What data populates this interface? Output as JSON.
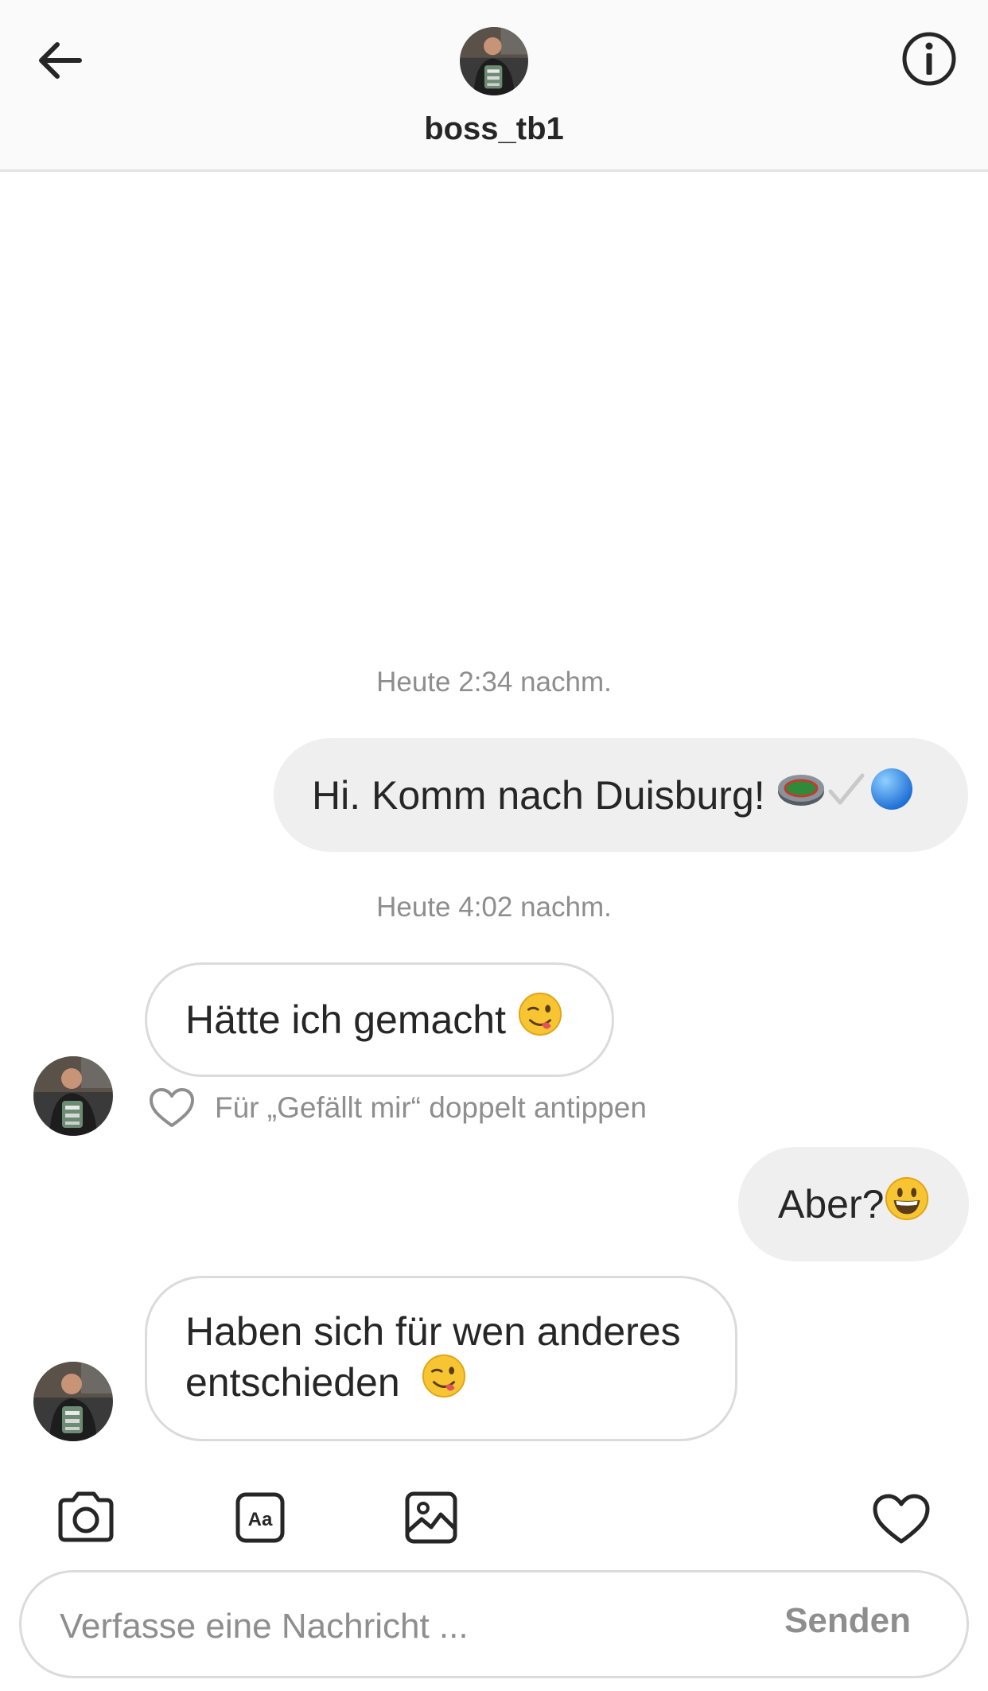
{
  "header": {
    "username": "boss_tb1",
    "back_icon": "arrow-left-icon",
    "info_icon": "info-circle-icon"
  },
  "thread": {
    "timestamp_1": "Heute 2:34 nachm.",
    "message_1": {
      "direction": "outgoing",
      "text": "Hi. Komm nach Duisburg!",
      "emojis": [
        "stadium-emoji",
        "check-mark-emoji",
        "blue-circle-emoji"
      ]
    },
    "timestamp_2": "Heute 4:02 nachm.",
    "message_2": {
      "direction": "incoming",
      "text": "Hätte ich gemacht",
      "emojis": [
        "winking-face-with-tongue-emoji"
      ]
    },
    "like_hint": "Für „Gefällt mir“ doppelt antippen",
    "message_3": {
      "direction": "outgoing",
      "text": "Aber?",
      "emojis": [
        "grinning-face-emoji"
      ]
    },
    "message_4": {
      "direction": "incoming",
      "text": "Haben sich für wen anderes\nentschieden",
      "emojis": [
        "winking-face-with-tongue-emoji"
      ]
    }
  },
  "toolbar": {
    "camera_icon": "camera-icon",
    "text_style_icon": "text-style-aa-icon",
    "text_style_label": "Aa",
    "gallery_icon": "image-gallery-icon",
    "heart_icon": "heart-outline-icon"
  },
  "composer": {
    "placeholder": "Verfasse eine Nachricht ...",
    "send_label": "Senden"
  },
  "colors": {
    "outgoing_bubble": "#efefef",
    "incoming_border": "#dbdbdb",
    "secondary_text": "#8e8e8e",
    "primary_text": "#262626"
  }
}
